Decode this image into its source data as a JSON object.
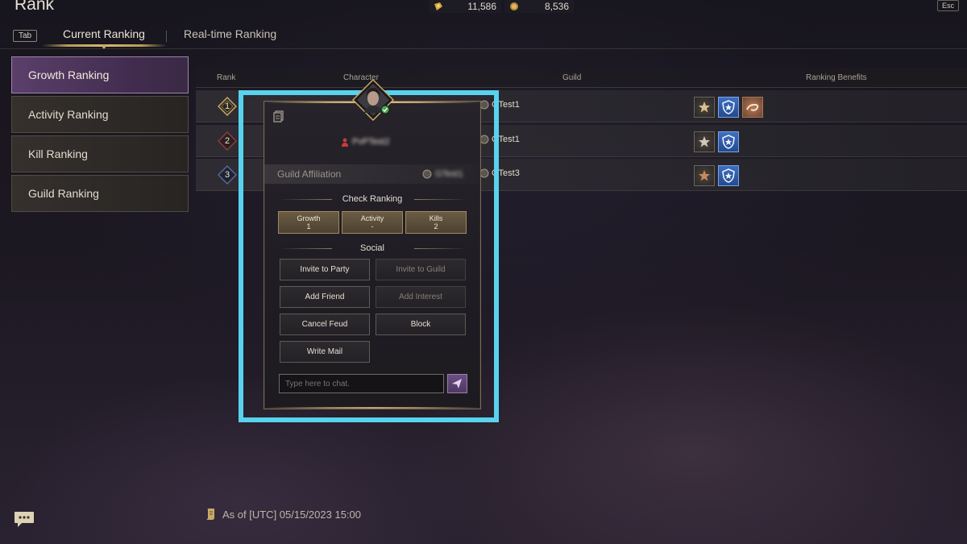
{
  "header": {
    "title": "Rank",
    "currency_a": "11,586",
    "currency_b": "8,536",
    "esc_label": "Esc"
  },
  "tabs": {
    "key_hint": "Tab",
    "current": "Current Ranking",
    "realtime": "Real-time Ranking"
  },
  "sidebar": {
    "items": [
      {
        "label": "Growth Ranking",
        "active": true
      },
      {
        "label": "Activity Ranking",
        "active": false
      },
      {
        "label": "Kill Ranking",
        "active": false
      },
      {
        "label": "Guild Ranking",
        "active": false
      }
    ]
  },
  "table": {
    "columns": [
      "Rank",
      "Character",
      "Guild",
      "Ranking Benefits"
    ],
    "rows": [
      {
        "rank": "1",
        "guild": "GTest1",
        "benefits": [
          "star-badge",
          "shield-badge",
          "swirl-badge"
        ]
      },
      {
        "rank": "2",
        "guild": "GTest1",
        "benefits": [
          "star-badge",
          "shield-badge"
        ]
      },
      {
        "rank": "3",
        "guild": "GTest3",
        "benefits": [
          "star-badge",
          "shield-badge"
        ]
      }
    ]
  },
  "popup": {
    "character_name": "PvPTest2",
    "guild_affiliation_label": "Guild Affiliation",
    "guild_affiliation_value": "GTest1",
    "check_ranking_title": "Check Ranking",
    "stats": [
      {
        "label": "Growth",
        "value": "1"
      },
      {
        "label": "Activity",
        "value": "-"
      },
      {
        "label": "Kills",
        "value": "2"
      }
    ],
    "social_title": "Social",
    "buttons": {
      "invite_party": "Invite to Party",
      "invite_guild": "Invite to Guild",
      "add_friend": "Add Friend",
      "add_interest": "Add Interest",
      "cancel_feud": "Cancel Feud",
      "block": "Block",
      "write_mail": "Write Mail"
    },
    "chat_placeholder": "Type here to chat."
  },
  "footer": {
    "timestamp": "As of [UTC] 05/15/2023 15:00"
  },
  "colors": {
    "highlight": "#58d3ee",
    "active_tab": "#5a3f6a",
    "gold_accent": "#c9a968"
  }
}
